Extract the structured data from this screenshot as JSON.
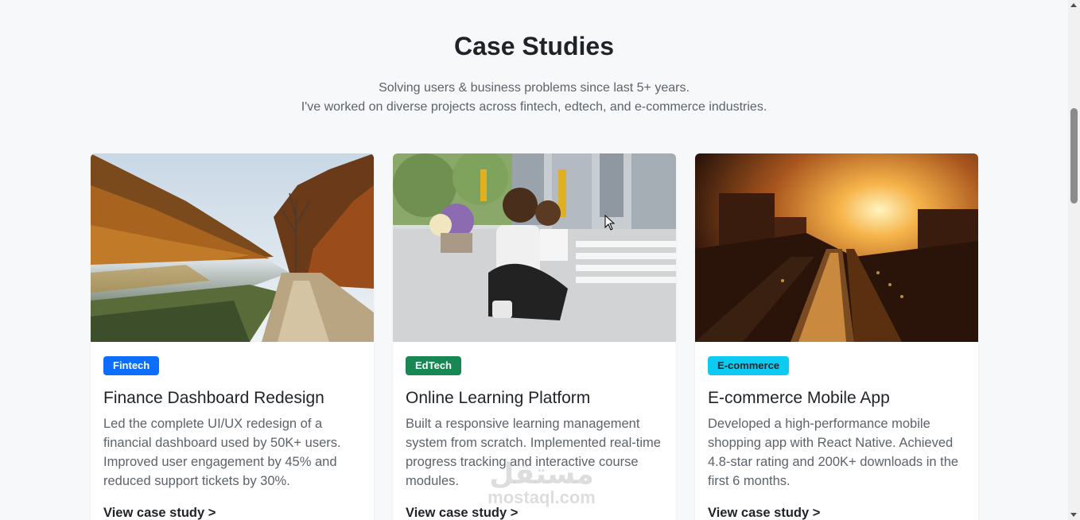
{
  "header": {
    "title": "Case Studies",
    "subtitle_line1": "Solving users & business problems since last 5+ years.",
    "subtitle_line2": "I've worked on diverse projects across fintech, edtech, and e-commerce industries."
  },
  "cards": [
    {
      "badge": "Fintech",
      "badge_color": "#0d6efd",
      "badge_text_color": "#ffffff",
      "title": "Finance Dashboard Redesign",
      "desc": "Led the complete UI/UX redesign of a financial dashboard used by 50K+ users. Improved user engagement by 45% and reduced support tickets by 30%.",
      "link": "View case study >"
    },
    {
      "badge": "EdTech",
      "badge_color": "#198754",
      "badge_text_color": "#ffffff",
      "title": "Online Learning Platform",
      "desc": "Built a responsive learning management system from scratch. Implemented real-time progress tracking and interactive course modules.",
      "link": "View case study >"
    },
    {
      "badge": "E-commerce",
      "badge_color": "#0dcaf0",
      "badge_text_color": "#1f2328",
      "title": "E-commerce Mobile App",
      "desc": "Developed a high-performance mobile shopping app with React Native. Achieved 4.8-star rating and 200K+ downloads in the first 6 months.",
      "link": "View case study >"
    }
  ],
  "watermark": {
    "line1": "مستقل",
    "line2": "mostaql.com"
  }
}
